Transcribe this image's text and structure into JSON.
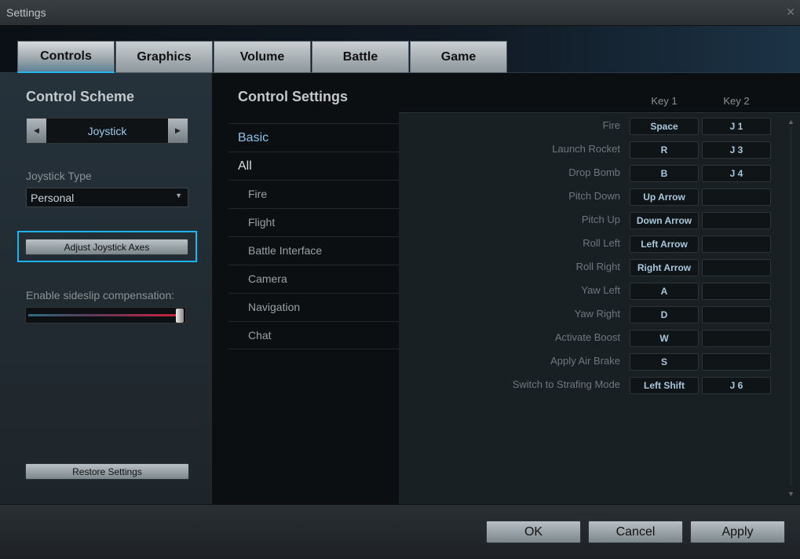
{
  "window": {
    "title": "Settings",
    "close_icon": "close-icon"
  },
  "tabs": [
    {
      "label": "Controls",
      "active": true
    },
    {
      "label": "Graphics"
    },
    {
      "label": "Volume"
    },
    {
      "label": "Battle"
    },
    {
      "label": "Game"
    }
  ],
  "left": {
    "heading": "Control Scheme",
    "scheme": "Joystick",
    "joystick_type_label": "Joystick Type",
    "joystick_type": "Personal",
    "adjust_axes": "Adjust Joystick Axes",
    "sideslip_label": "Enable sideslip compensation:",
    "sideslip_value_percent": 100,
    "restore": "Restore Settings"
  },
  "right": {
    "heading": "Control Settings",
    "categories": [
      "Basic",
      "All"
    ],
    "subcategories": [
      "Fire",
      "Flight",
      "Battle Interface",
      "Camera",
      "Navigation",
      "Chat"
    ],
    "key1_header": "Key 1",
    "key2_header": "Key 2",
    "bindings": [
      {
        "action": "Fire",
        "key1": "Space",
        "key2": "J 1"
      },
      {
        "action": "Launch Rocket",
        "key1": "R",
        "key2": "J 3"
      },
      {
        "action": "Drop Bomb",
        "key1": "B",
        "key2": "J 4"
      },
      {
        "action": "Pitch Down",
        "key1": "Up Arrow",
        "key2": ""
      },
      {
        "action": "Pitch Up",
        "key1": "Down Arrow",
        "key2": ""
      },
      {
        "action": "Roll Left",
        "key1": "Left Arrow",
        "key2": ""
      },
      {
        "action": "Roll Right",
        "key1": "Right Arrow",
        "key2": ""
      },
      {
        "action": "Yaw Left",
        "key1": "A",
        "key2": ""
      },
      {
        "action": "Yaw Right",
        "key1": "D",
        "key2": ""
      },
      {
        "action": "Activate Boost",
        "key1": "W",
        "key2": ""
      },
      {
        "action": "Apply Air Brake",
        "key1": "S",
        "key2": ""
      },
      {
        "action": "Switch to Strafing Mode",
        "key1": "Left Shift",
        "key2": "J 6"
      }
    ]
  },
  "footer": {
    "ok": "OK",
    "cancel": "Cancel",
    "apply": "Apply"
  },
  "colors": {
    "accent": "#27b6f0",
    "slider_fill": "#d0213f",
    "link": "#8fc3e6"
  }
}
